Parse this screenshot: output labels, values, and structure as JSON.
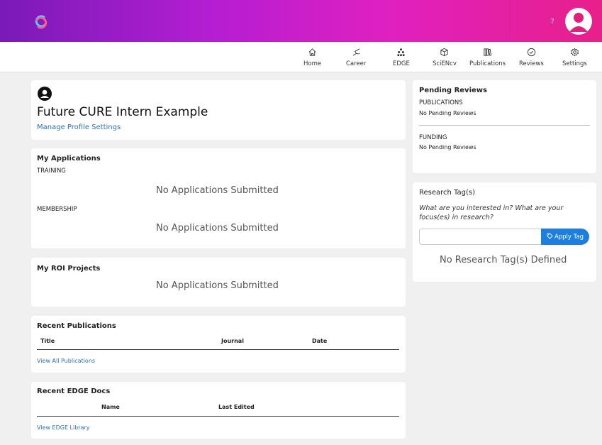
{
  "header": {
    "help_label": "?"
  },
  "nav": [
    {
      "label": "Home",
      "icon": "home-icon"
    },
    {
      "label": "Career",
      "icon": "career-icon"
    },
    {
      "label": "EDGE",
      "icon": "edge-icon"
    },
    {
      "label": "SciENcv",
      "icon": "cube-icon"
    },
    {
      "label": "Publications",
      "icon": "books-icon"
    },
    {
      "label": "Reviews",
      "icon": "check-circle-icon"
    },
    {
      "label": "Settings",
      "icon": "gear-icon"
    }
  ],
  "profile": {
    "name": "Future CURE Intern Example",
    "settings_link": "Manage Profile Settings"
  },
  "applications": {
    "title": "My Applications",
    "training_label": "TRAINING",
    "training_empty": "No Applications Submitted",
    "membership_label": "MEMBERSHIP",
    "membership_empty": "No Applications Submitted"
  },
  "roi": {
    "title": "My ROI Projects",
    "empty": "No Applications Submitted"
  },
  "publications": {
    "title": "Recent Publications",
    "columns": [
      "Title",
      "Journal",
      "Date"
    ],
    "view_all": "View All Publications"
  },
  "edge_docs": {
    "title": "Recent EDGE Docs",
    "columns": [
      "Name",
      "Last Edited"
    ],
    "view_all": "View EDGE Library"
  },
  "pending_reviews": {
    "title": "Pending Reviews",
    "publications_label": "PUBLICATIONS",
    "publications_empty": "No Pending Reviews",
    "funding_label": "FUNDING",
    "funding_empty": "No Pending Reviews"
  },
  "research_tags": {
    "title": "Research Tag(s)",
    "prompt": "What are you interested in? What are your focus(es) in research?",
    "input_value": "",
    "apply_label": "Apply Tag",
    "empty": "No Research Tag(s) Defined"
  },
  "colors": {
    "accent": "#2a6fc0",
    "apply_button": "#1a7fe0",
    "header_start": "#7a1ab8",
    "header_end": "#e8208a"
  }
}
